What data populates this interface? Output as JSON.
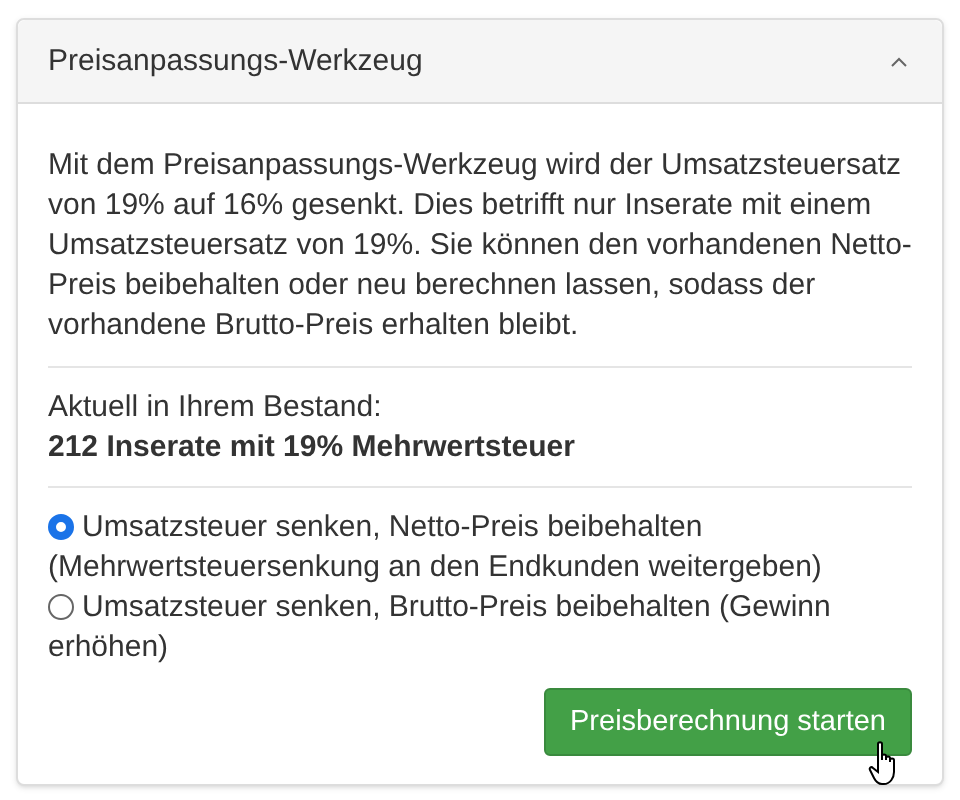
{
  "panel": {
    "title": "Preisanpassungs-Werkzeug",
    "expanded": true
  },
  "description": "Mit dem Preisanpassungs-Werkzeug wird der Umsatzsteuersatz von 19% auf 16% gesenkt. Dies betrifft nur Inserate mit einem Umsatzsteuersatz von 19%. Sie können den vorhandenen Netto-Preis beibehalten oder neu berechnen lassen, sodass der vorhandene Brutto-Preis erhalten bleibt.",
  "inventory": {
    "label": "Aktuell in Ihrem Bestand:",
    "value": "212 Inserate mit 19% Mehrwertsteuer"
  },
  "options": [
    {
      "label": "Umsatzsteuer senken, Netto-Preis beibehalten (Mehrwertsteuersenkung an den Endkunden weitergeben)",
      "selected": true
    },
    {
      "label": "Umsatzsteuer senken, Brutto-Preis beibehalten (Gewinn erhöhen)",
      "selected": false
    }
  ],
  "button": {
    "label": "Preisberechnung starten"
  }
}
